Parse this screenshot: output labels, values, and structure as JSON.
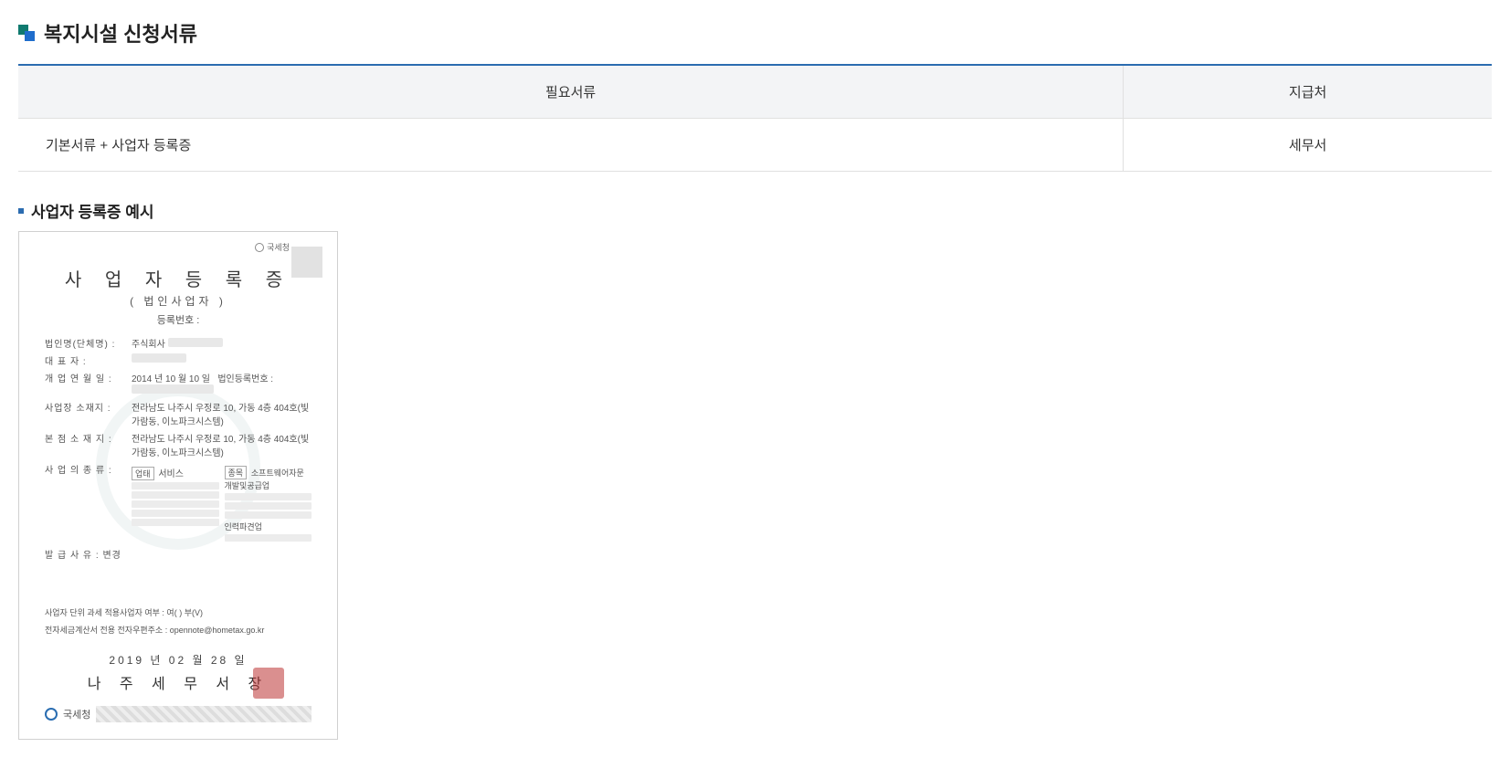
{
  "main": {
    "title": "복지시설 신청서류",
    "table": {
      "headers": [
        "필요서류",
        "지급처"
      ],
      "rows": [
        {
          "docs": "기본서류 + 사업자 등록증",
          "issuer": "세무서"
        }
      ]
    },
    "example_title": "사업자 등록증 예시"
  },
  "cert": {
    "top_right_label": "국세청",
    "title": "사 업 자 등 록 증",
    "subtitle": "( 법인사업자 )",
    "reg_label": "등록번호 :",
    "fields": {
      "corp_name": {
        "label": "법인명(단체명) :",
        "value": "주식회사"
      },
      "ceo": {
        "label": "대    표    자 :",
        "value": ""
      },
      "open_date": {
        "label": "개 업 연 월 일 :",
        "value": "2014 년 10 월 10 일",
        "extra_label": "법인등록번호 :"
      },
      "address": {
        "label": "사업장 소재지 :",
        "value": "전라남도 나주시 우정로 10, 가동 4층 404호(빛가람동, 이노파크시스템)"
      },
      "hq": {
        "label": "본 점 소 재 지 :",
        "value": "전라남도 나주시 우정로 10, 가동 4층 404호(빛가람동, 이노파크시스템)"
      },
      "biztype": {
        "label": "사 업 의 종 류 :",
        "tag1": "업태",
        "val1": "서비스",
        "tag2": "종목",
        "val2": "소프트웨어자문개발및공급업"
      },
      "remark": {
        "label": "발 급 사 유 : 변경"
      },
      "people": {
        "value": "인력파견업"
      }
    },
    "bottom": {
      "note1": "사업자 단위 과세 적용사업자 여부 : 여(   ) 부(V)",
      "note2": "전자세금계산서 전용 전자우편주소 : opennote@hometax.go.kr",
      "issue_date": "2019 년 02 월 28 일",
      "issuer": "나 주 세 무 서 장",
      "footer_org": "국세청"
    }
  }
}
